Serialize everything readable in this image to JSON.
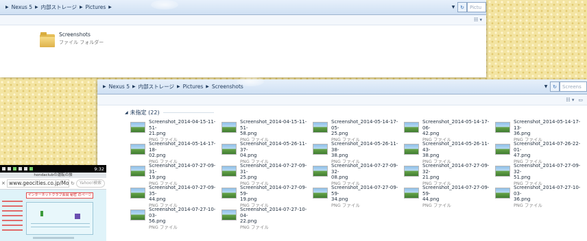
{
  "colors": {
    "wallpaper": "#f3e4a2",
    "address_bar": "#cfe0f3",
    "crumb_text": "#1e395b",
    "file_type_text": "#858585"
  },
  "window_pictures": {
    "breadcrumb": [
      "Nexus 5",
      "内部ストレージ",
      "Pictures"
    ],
    "search_placeholder": "Pictu",
    "folder": {
      "name": "Screenshots",
      "type": "ファイル フォルダー",
      "icon": "folder-icon"
    }
  },
  "window_screenshots": {
    "breadcrumb": [
      "Nexus 5",
      "内部ストレージ",
      "Pictures",
      "Screenshots"
    ],
    "search_placeholder": "Screens",
    "group_label": "未指定 (22)",
    "file_type": "PNG ファイル",
    "files": [
      {
        "line1": "Screenshot_2014-04-15-11-51-",
        "line2": "21.png"
      },
      {
        "line1": "Screenshot_2014-04-15-11-51-",
        "line2": "58.png"
      },
      {
        "line1": "Screenshot_2014-05-14-17-05-",
        "line2": "25.png"
      },
      {
        "line1": "Screenshot_2014-05-14-17-06-",
        "line2": "42.png"
      },
      {
        "line1": "Screenshot_2014-05-14-17-13-",
        "line2": "36.png"
      },
      {
        "line1": "Screenshot_2014-05-14-17-18-",
        "line2": "02.png"
      },
      {
        "line1": "Screenshot_2014-05-26-11-37-",
        "line2": "04.png"
      },
      {
        "line1": "Screenshot_2014-05-26-11-38-",
        "line2": "38.png"
      },
      {
        "line1": "Screenshot_2014-05-26-11-43-",
        "line2": "38.png"
      },
      {
        "line1": "Screenshot_2014-07-26-22-01-",
        "line2": "47.png"
      },
      {
        "line1": "Screenshot_2014-07-27-09-31-",
        "line2": "19.png"
      },
      {
        "line1": "Screenshot_2014-07-27-09-31-",
        "line2": "25.png"
      },
      {
        "line1": "Screenshot_2014-07-27-09-32-",
        "line2": "08.png"
      },
      {
        "line1": "Screenshot_2014-07-27-09-32-",
        "line2": "21.png"
      },
      {
        "line1": "Screenshot_2014-07-27-09-32-",
        "line2": "51.png"
      },
      {
        "line1": "Screenshot_2014-07-27-09-35-",
        "line2": "44.png"
      },
      {
        "line1": "Screenshot_2014-07-27-09-59-",
        "line2": "19.png"
      },
      {
        "line1": "Screenshot_2014-07-27-09-59-",
        "line2": "34.png"
      },
      {
        "line1": "Screenshot_2014-07-27-09-59-",
        "line2": "44.png"
      },
      {
        "line1": "Screenshot_2014-07-27-10-03-",
        "line2": "36.png"
      },
      {
        "line1": "Screenshot_2014-07-27-10-03-",
        "line2": "56.png"
      },
      {
        "line1": "Screenshot_2014-07-27-10-04-",
        "line2": "22.png"
      }
    ]
  },
  "phone": {
    "clock": "9:32",
    "tab_title": "hondaclubの運転の旅",
    "url": "www.geocities.co.jp/Mo...",
    "search_placeholder": "Yahoo!検索",
    "banner_text": "インターネットクラブ会員 秘密 のページ"
  }
}
